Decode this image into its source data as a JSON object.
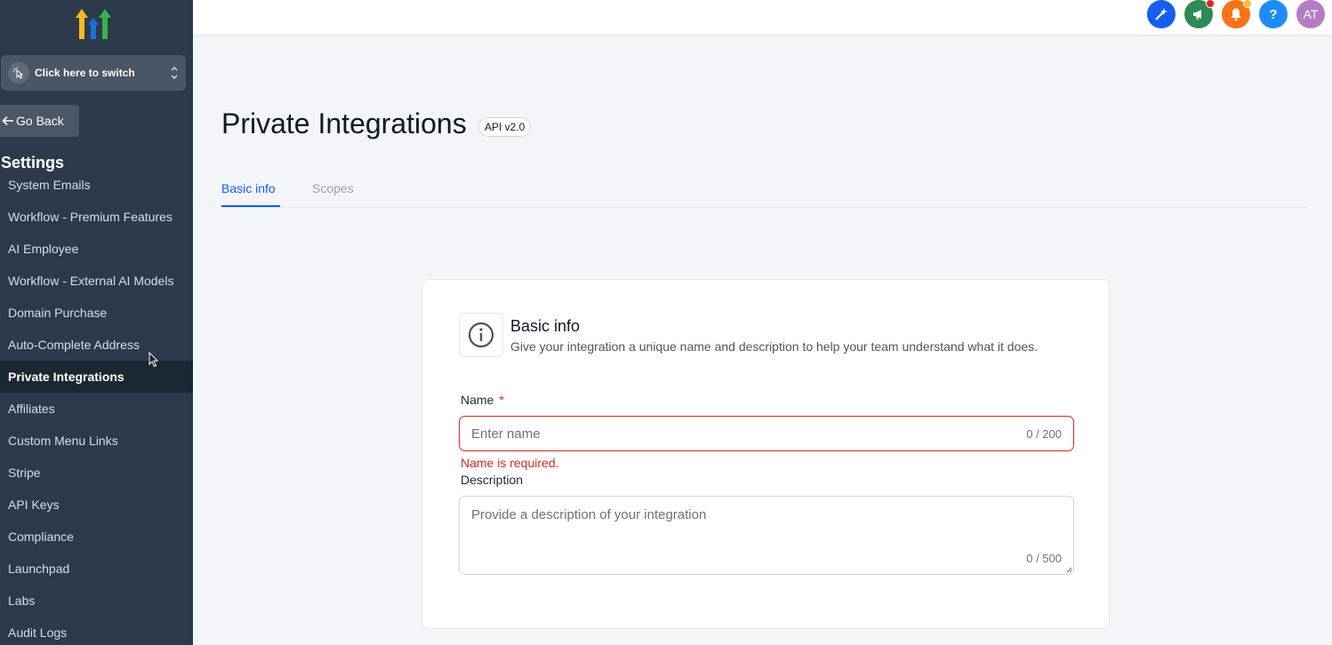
{
  "sidebar": {
    "switcher_label": "Click here to switch",
    "go_back_label": "Go Back",
    "section_title": "Settings",
    "items": [
      {
        "label": "System Emails"
      },
      {
        "label": "Workflow - Premium Features"
      },
      {
        "label": "AI Employee"
      },
      {
        "label": "Workflow - External AI Models"
      },
      {
        "label": "Domain Purchase"
      },
      {
        "label": "Auto-Complete Address"
      },
      {
        "label": "Private Integrations",
        "active": true
      },
      {
        "label": "Affiliates"
      },
      {
        "label": "Custom Menu Links"
      },
      {
        "label": "Stripe"
      },
      {
        "label": "API Keys"
      },
      {
        "label": "Compliance"
      },
      {
        "label": "Launchpad"
      },
      {
        "label": "Labs"
      },
      {
        "label": "Audit Logs"
      }
    ]
  },
  "topbar": {
    "buttons": [
      {
        "icon": "sparkle-icon",
        "color": "#155eef"
      },
      {
        "icon": "megaphone-icon",
        "color": "#2e8b57",
        "badge": "#e02424"
      },
      {
        "icon": "bell-icon",
        "color": "#f97316",
        "badge": "#fbbf24"
      },
      {
        "icon": "help-icon",
        "label": "?",
        "color": "#1d8cf8"
      },
      {
        "icon": "avatar",
        "label": "AT",
        "color": "#b57cc4"
      }
    ]
  },
  "page": {
    "title": "Private Integrations",
    "api_badge": "API v2.0",
    "tabs": [
      {
        "label": "Basic info",
        "active": true
      },
      {
        "label": "Scopes",
        "active": false
      }
    ]
  },
  "card": {
    "title": "Basic info",
    "subtitle": "Give your integration a unique name and description to help your team understand what it does.",
    "name_label": "Name",
    "required_mark": "*",
    "name_placeholder": "Enter name",
    "name_counter": "0 / 200",
    "name_error": "Name is required.",
    "description_label": "Description",
    "description_placeholder": "Provide a description of your integration",
    "description_counter": "0 / 500"
  },
  "colors": {
    "sidebar_bg": "#2c3a4b",
    "accent": "#155eef",
    "error": "#dc2626"
  }
}
